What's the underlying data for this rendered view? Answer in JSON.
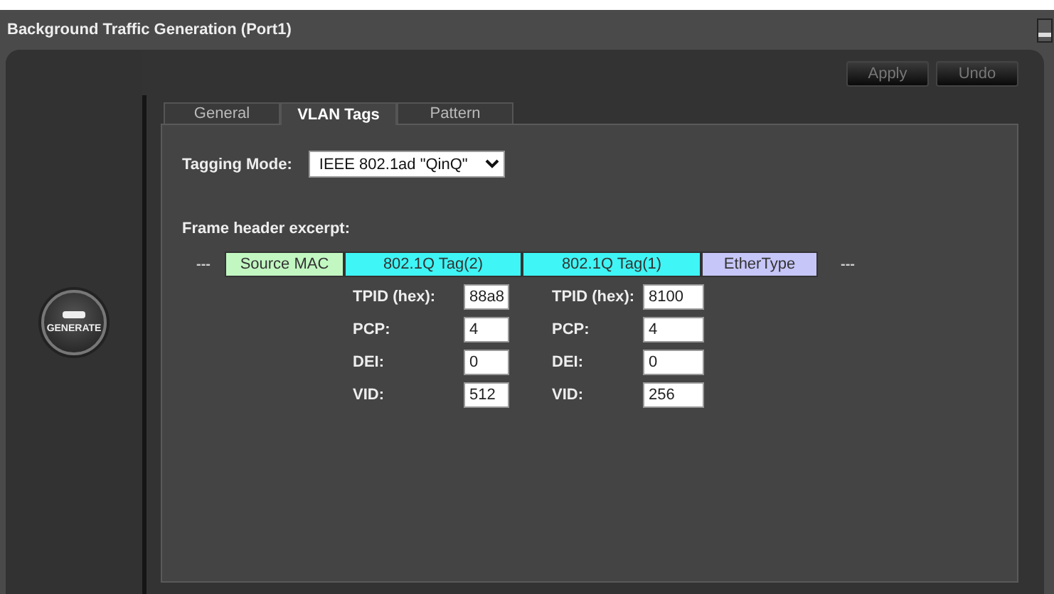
{
  "window": {
    "title": "Background Traffic Generation (Port1)"
  },
  "generate_button": {
    "label": "GENERATE"
  },
  "actions": [
    "Apply",
    "Undo"
  ],
  "tabs": [
    {
      "label": "General",
      "selected": false
    },
    {
      "label": "VLAN Tags",
      "selected": true
    },
    {
      "label": "Pattern",
      "selected": false
    }
  ],
  "tagging_mode": {
    "label": "Tagging Mode:",
    "value": "IEEE 802.1ad \"QinQ\""
  },
  "frame_header": {
    "label": "Frame header excerpt:",
    "prefix": "---",
    "suffix": "---",
    "segments": [
      {
        "label": "Source MAC",
        "color": "#c2f7c2"
      },
      {
        "label": "802.1Q Tag(2)",
        "color": "#3ff5f5"
      },
      {
        "label": "802.1Q Tag(1)",
        "color": "#3ff5f5"
      },
      {
        "label": "EtherType",
        "color": "#c6c6f8"
      }
    ]
  },
  "tags": [
    {
      "fields": [
        {
          "label": "TPID (hex):",
          "value": "88a8"
        },
        {
          "label": "PCP:",
          "value": "4"
        },
        {
          "label": "DEI:",
          "value": "0"
        },
        {
          "label": "VID:",
          "value": "512"
        }
      ]
    },
    {
      "fields": [
        {
          "label": "TPID (hex):",
          "value": "8100"
        },
        {
          "label": "PCP:",
          "value": "4"
        },
        {
          "label": "DEI:",
          "value": "0"
        },
        {
          "label": "VID:",
          "value": "256"
        }
      ]
    }
  ]
}
